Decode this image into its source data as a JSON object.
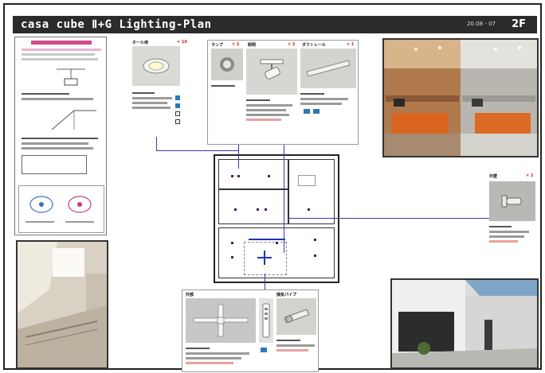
{
  "header": {
    "title": "casa cube Ⅱ+G  Lighting-Plan",
    "date": "20.08 - 07",
    "floor": "2F"
  },
  "products": {
    "hall": {
      "name": "ホール用",
      "qty": "× 10"
    },
    "lamp": {
      "name": "ランプ",
      "qty": "× 2"
    },
    "spot": {
      "name": "照明",
      "qty": "× 2"
    },
    "duct": {
      "name": "ダクトレール",
      "qty": "× 1"
    },
    "wall": {
      "name": "外壁",
      "qty": "× 2"
    },
    "fan": {
      "name": "外部"
    },
    "pipe": {
      "name": "換気パイプ"
    }
  },
  "colors": {
    "header_bg": "#2b2b2b",
    "wiring": "#3a3aa8",
    "quantity_text": "#d0202a",
    "fixture_marker": "#4a1a6a"
  },
  "icons": [
    "downlight-icon",
    "spotlight-icon",
    "duct-rail-icon",
    "wall-light-icon",
    "ceiling-fan-icon",
    "remote-control-icon",
    "vent-pipe-icon",
    "fan-rotation-icon",
    "pendant-icon",
    "light-mark-icon"
  ]
}
